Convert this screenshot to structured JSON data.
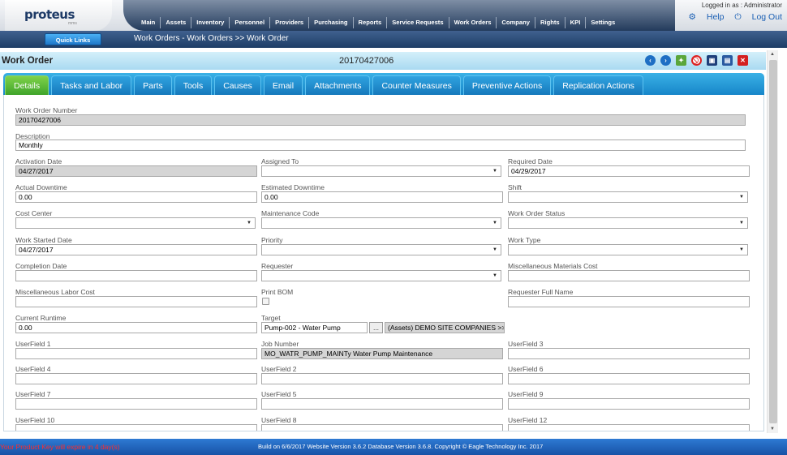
{
  "app": {
    "brand": "proteus",
    "brand_sub": "mms"
  },
  "nav": [
    "Main",
    "Assets",
    "Inventory",
    "Personnel",
    "Providers",
    "Purchasing",
    "Reports",
    "Service Requests",
    "Work Orders",
    "Company",
    "Rights",
    "KPI",
    "Settings"
  ],
  "user": {
    "logged_in": "Logged in as : Administrator",
    "help": "Help",
    "logout": "Log Out"
  },
  "subbar": {
    "quick_links": "Quick Links",
    "breadcrumb": "Work Orders - Work Orders >> Work Order"
  },
  "header": {
    "title": "Work Order",
    "number": "20170427006"
  },
  "toolbar_icons": [
    "prev-icon",
    "next-icon",
    "copy-icon",
    "cancel-icon",
    "save-icon",
    "print-icon",
    "close-icon"
  ],
  "tabs": [
    "Details",
    "Tasks and Labor",
    "Parts",
    "Tools",
    "Causes",
    "Email",
    "Attachments",
    "Counter Measures",
    "Preventive Actions",
    "Replication Actions"
  ],
  "fields": {
    "wo_number": {
      "label": "Work Order Number",
      "value": "20170427006"
    },
    "description": {
      "label": "Description",
      "value": "Monthly"
    },
    "activation_date": {
      "label": "Activation Date",
      "value": "04/27/2017"
    },
    "assigned_to": {
      "label": "Assigned To",
      "value": ""
    },
    "required_date": {
      "label": "Required Date",
      "value": "04/29/2017"
    },
    "actual_downtime": {
      "label": "Actual Downtime",
      "value": "0.00"
    },
    "estimated_downtime": {
      "label": "Estimated Downtime",
      "value": "0.00"
    },
    "shift": {
      "label": "Shift",
      "value": ""
    },
    "cost_center": {
      "label": "Cost Center",
      "value": ""
    },
    "maintenance_code": {
      "label": "Maintenance Code",
      "value": ""
    },
    "wo_status": {
      "label": "Work Order Status",
      "value": ""
    },
    "work_started": {
      "label": "Work Started Date",
      "value": "04/27/2017"
    },
    "priority": {
      "label": "Priority",
      "value": ""
    },
    "work_type": {
      "label": "Work Type",
      "value": ""
    },
    "completion_date": {
      "label": "Completion Date",
      "value": ""
    },
    "requester": {
      "label": "Requester",
      "value": ""
    },
    "misc_materials": {
      "label": "Miscellaneous Materials Cost",
      "value": ""
    },
    "misc_labor": {
      "label": "Miscellaneous Labor Cost",
      "value": ""
    },
    "print_bom": {
      "label": "Print BOM"
    },
    "requester_name": {
      "label": "Requester Full Name",
      "value": ""
    },
    "current_runtime": {
      "label": "Current Runtime",
      "value": "0.00"
    },
    "target": {
      "label": "Target",
      "value": "Pump-002 - Water Pump",
      "browse": "...",
      "link": "(Assets) DEMO SITE COMPANIES >>"
    },
    "userfield1": {
      "label": "UserField 1",
      "value": ""
    },
    "job_number": {
      "label": "Job Number",
      "value": "MO_WATR_PUMP_MAINTy Water Pump Maintenance"
    },
    "userfield3": {
      "label": "UserField 3",
      "value": ""
    },
    "userfield4": {
      "label": "UserField 4",
      "value": ""
    },
    "userfield2": {
      "label": "UserField 2",
      "value": ""
    },
    "userfield6": {
      "label": "UserField 6",
      "value": ""
    },
    "userfield7": {
      "label": "UserField 7",
      "value": ""
    },
    "userfield5": {
      "label": "UserField 5",
      "value": ""
    },
    "userfield9": {
      "label": "UserField 9",
      "value": ""
    },
    "userfield10": {
      "label": "UserField 10",
      "value": ""
    },
    "userfield8": {
      "label": "UserField 8",
      "value": ""
    },
    "userfield12": {
      "label": "UserField 12",
      "value": ""
    }
  },
  "footer": {
    "warning": "Your Product Key will expire in 4 day(s)",
    "build": "Build on 6/6/2017 Website Version 3.6.2 Database Version 3.6.8. Copyright © Eagle Technology Inc. 2017"
  }
}
